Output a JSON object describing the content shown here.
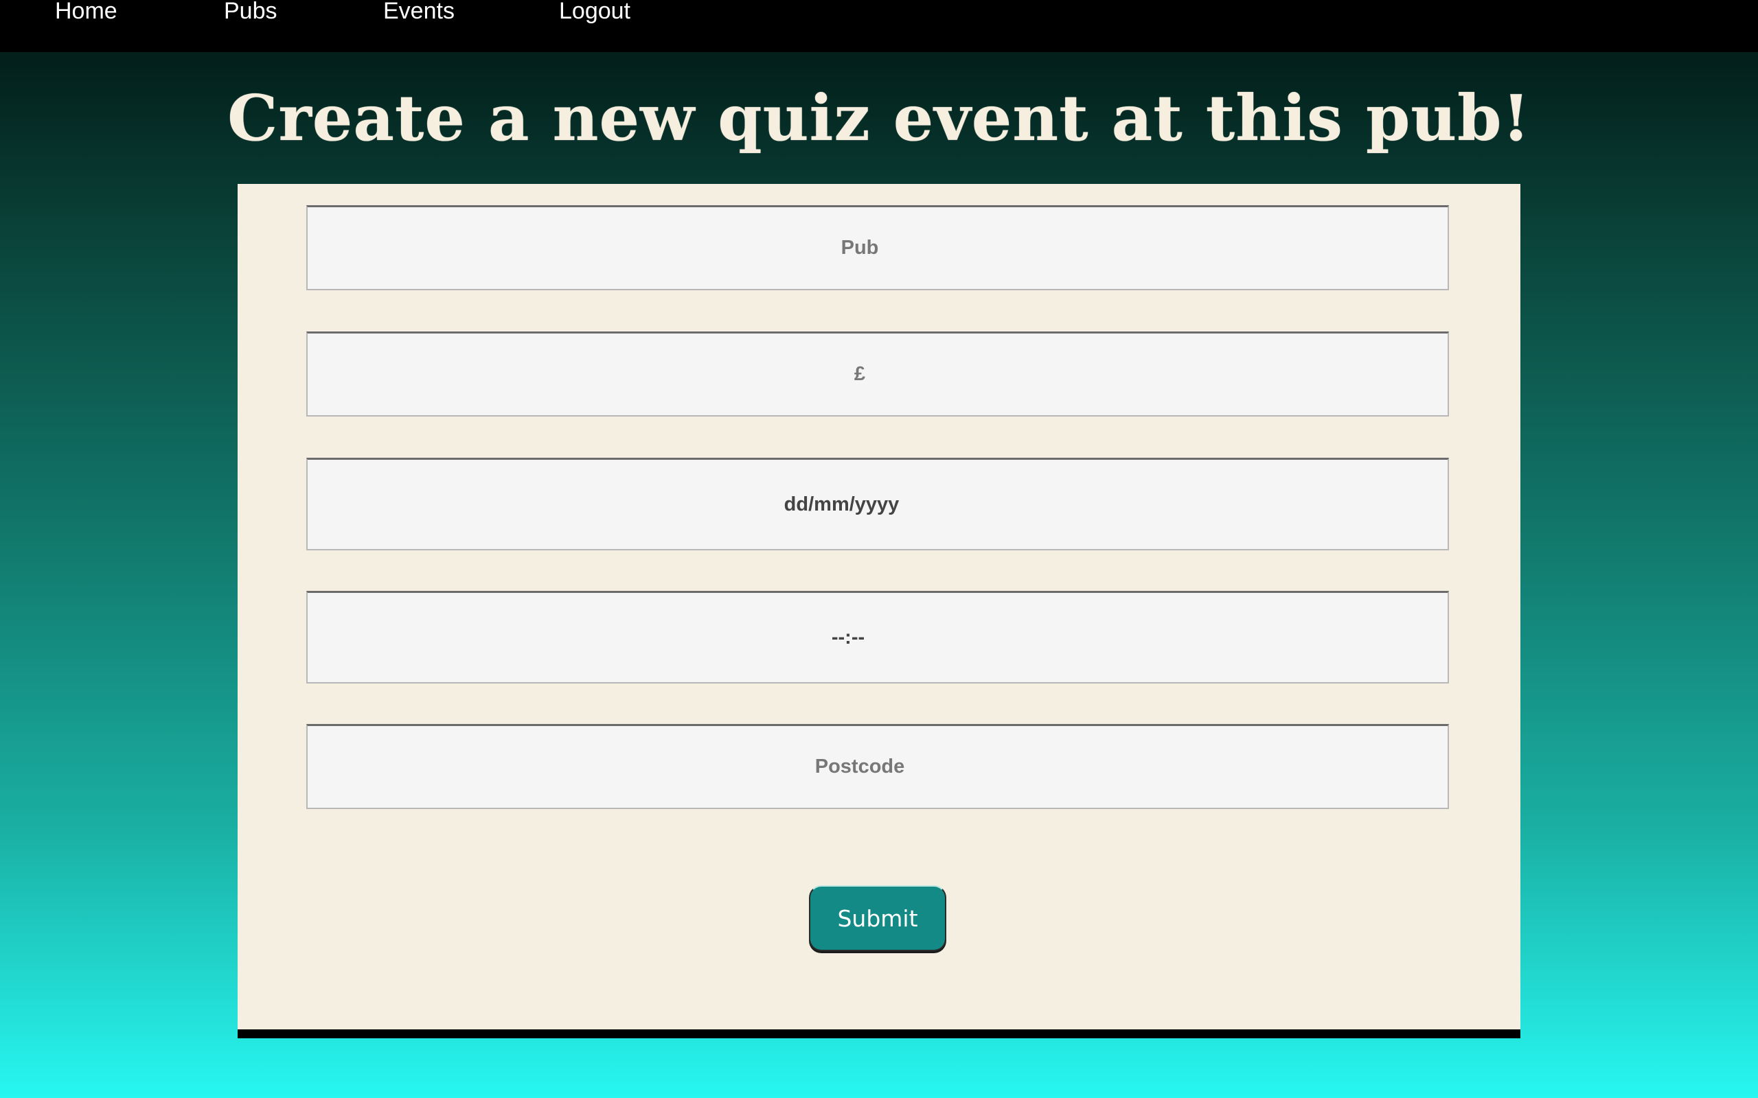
{
  "nav": {
    "items": [
      {
        "label": "Home"
      },
      {
        "label": "Pubs"
      },
      {
        "label": "Events"
      },
      {
        "label": "Logout"
      }
    ]
  },
  "page_title": "Create a new quiz event at this pub!",
  "form": {
    "pub": {
      "placeholder": "Pub",
      "value": ""
    },
    "price": {
      "placeholder": "£",
      "value": ""
    },
    "date": {
      "display": "dd/mm/yyyy"
    },
    "time": {
      "display": "--:--"
    },
    "postcode": {
      "placeholder": "Postcode",
      "value": ""
    },
    "submit_label": "Submit"
  },
  "colors": {
    "nav_background": "#000000",
    "title_color": "#f6efdf",
    "panel_background": "#f5efe2",
    "submit_background": "#138a85",
    "gradient_top": "#03201b",
    "gradient_bottom": "#27f7f1"
  }
}
